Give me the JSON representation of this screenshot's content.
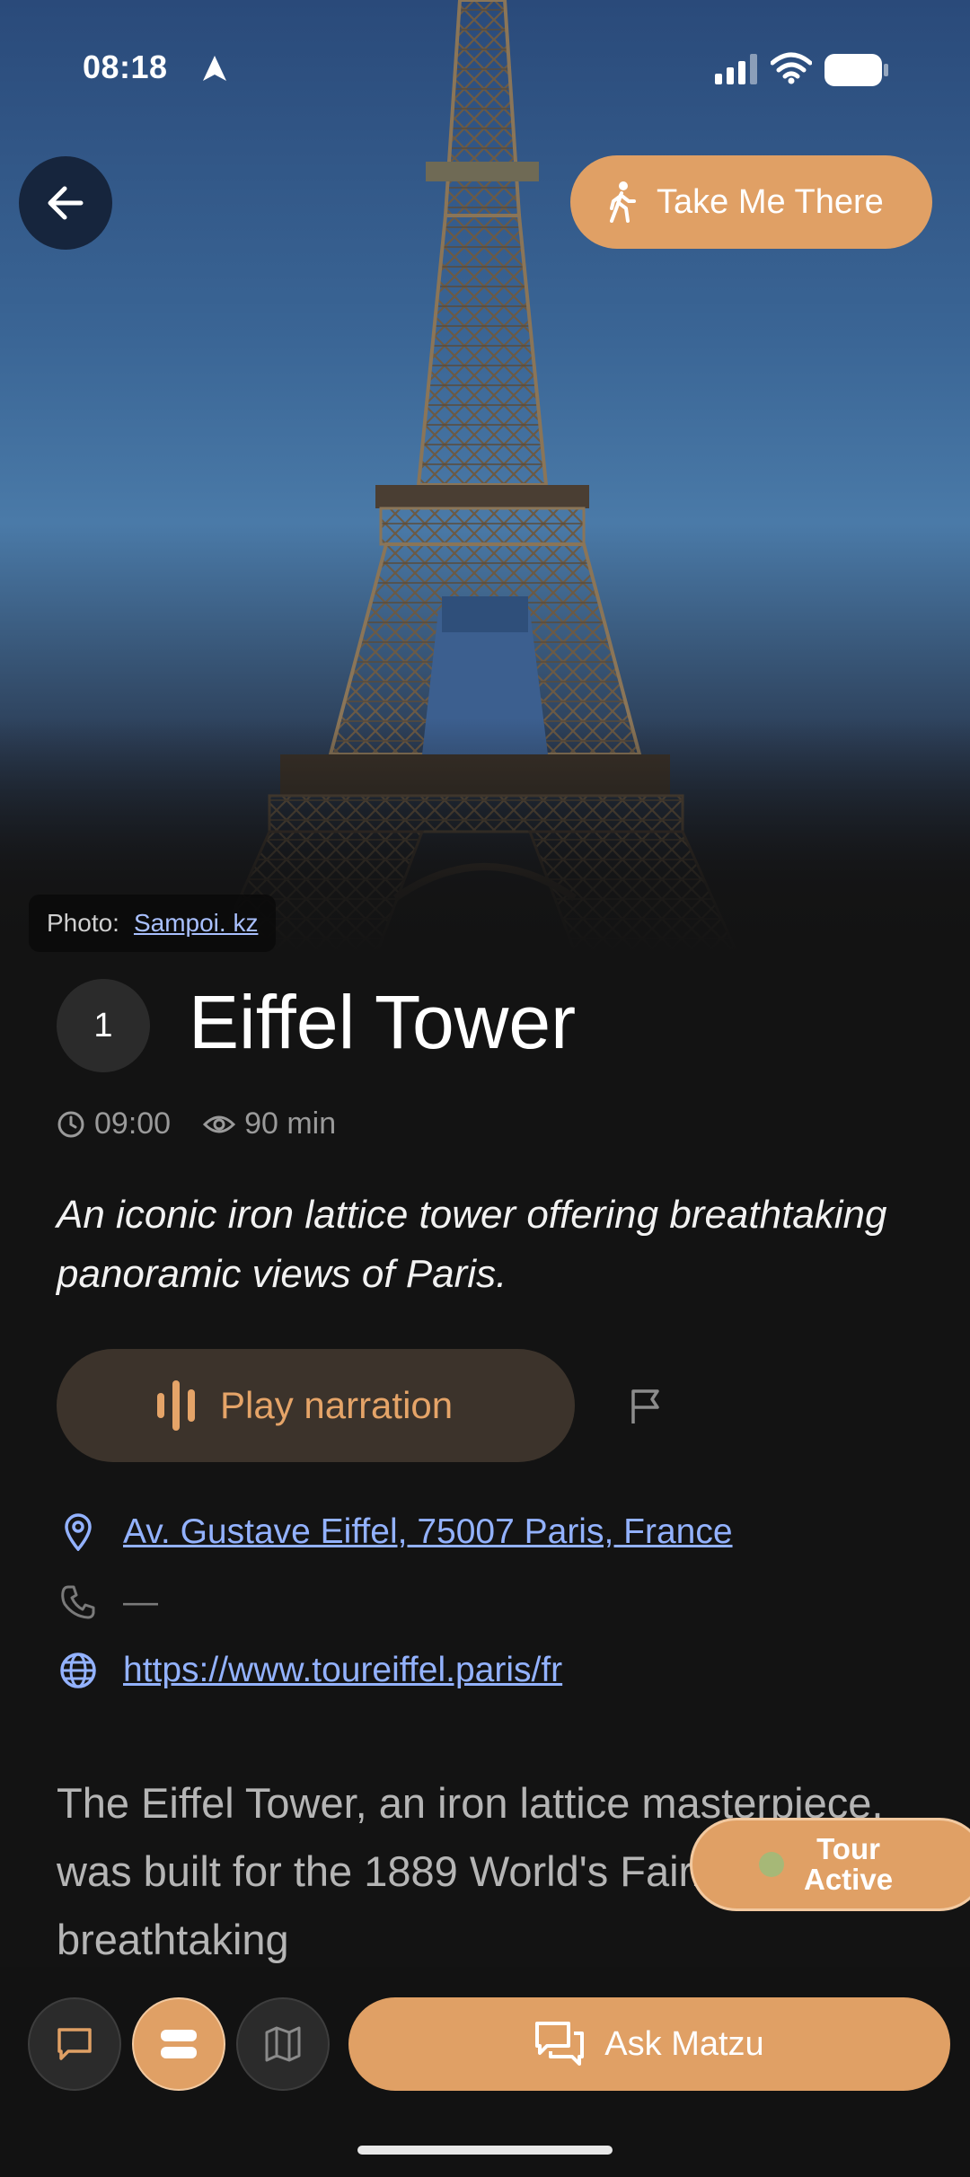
{
  "status_bar": {
    "time": "08:18"
  },
  "hero": {
    "take_me_there_label": "Take Me There",
    "photo_credit_prefix": "Photo:",
    "photo_credit_author": "Sampoi. kz"
  },
  "place": {
    "number": "1",
    "title": "Eiffel Tower",
    "time": "09:00",
    "duration": "90 min",
    "description": "An iconic iron lattice tower offering breathtaking panoramic views of Paris.",
    "play_label": "Play narration",
    "address": "Av. Gustave Eiffel, 75007 Paris, France",
    "phone": "—",
    "website": "https://www.toureiffel.paris/fr",
    "body": "The Eiffel Tower, an iron lattice masterpiece, was built for the 1889 World's Fair. It offers breathtaking"
  },
  "tour_badge": {
    "line1": "Tour",
    "line2": "Active"
  },
  "bottom_nav": {
    "ask_label": "Ask Matzu"
  },
  "colors": {
    "accent": "#e0a065",
    "link": "#93b2ff",
    "background": "#131313"
  }
}
